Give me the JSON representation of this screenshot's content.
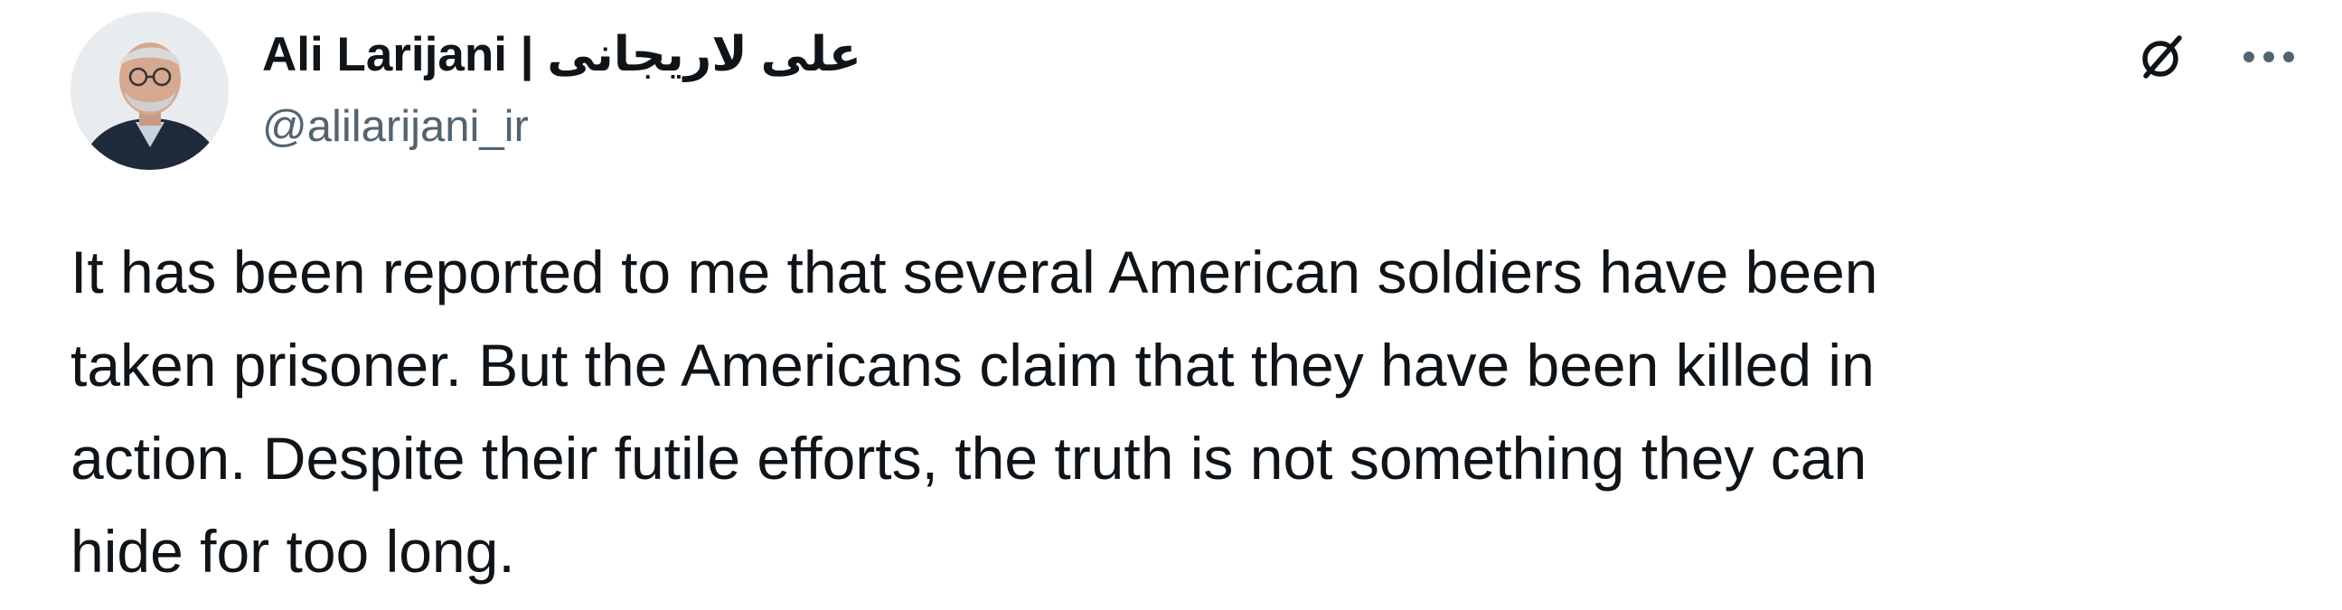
{
  "author": {
    "display_name": "Ali Larijani | علی لاریجانی",
    "handle": "@alilarijani_ir",
    "avatar_icon": "profile-photo"
  },
  "header_actions": {
    "grok_icon": "grok-icon",
    "more_icon": "more-horizontal-icon"
  },
  "tweet": {
    "text_lines": [
      "It has been reported to me that several American soldiers have been",
      "taken prisoner. But the Americans claim that they have been killed in",
      "action. Despite their futile efforts, the truth is not something they can",
      "hide for too long."
    ]
  },
  "colors": {
    "text_primary": "#0f1419",
    "text_secondary": "#536471",
    "background": "#ffffff"
  }
}
